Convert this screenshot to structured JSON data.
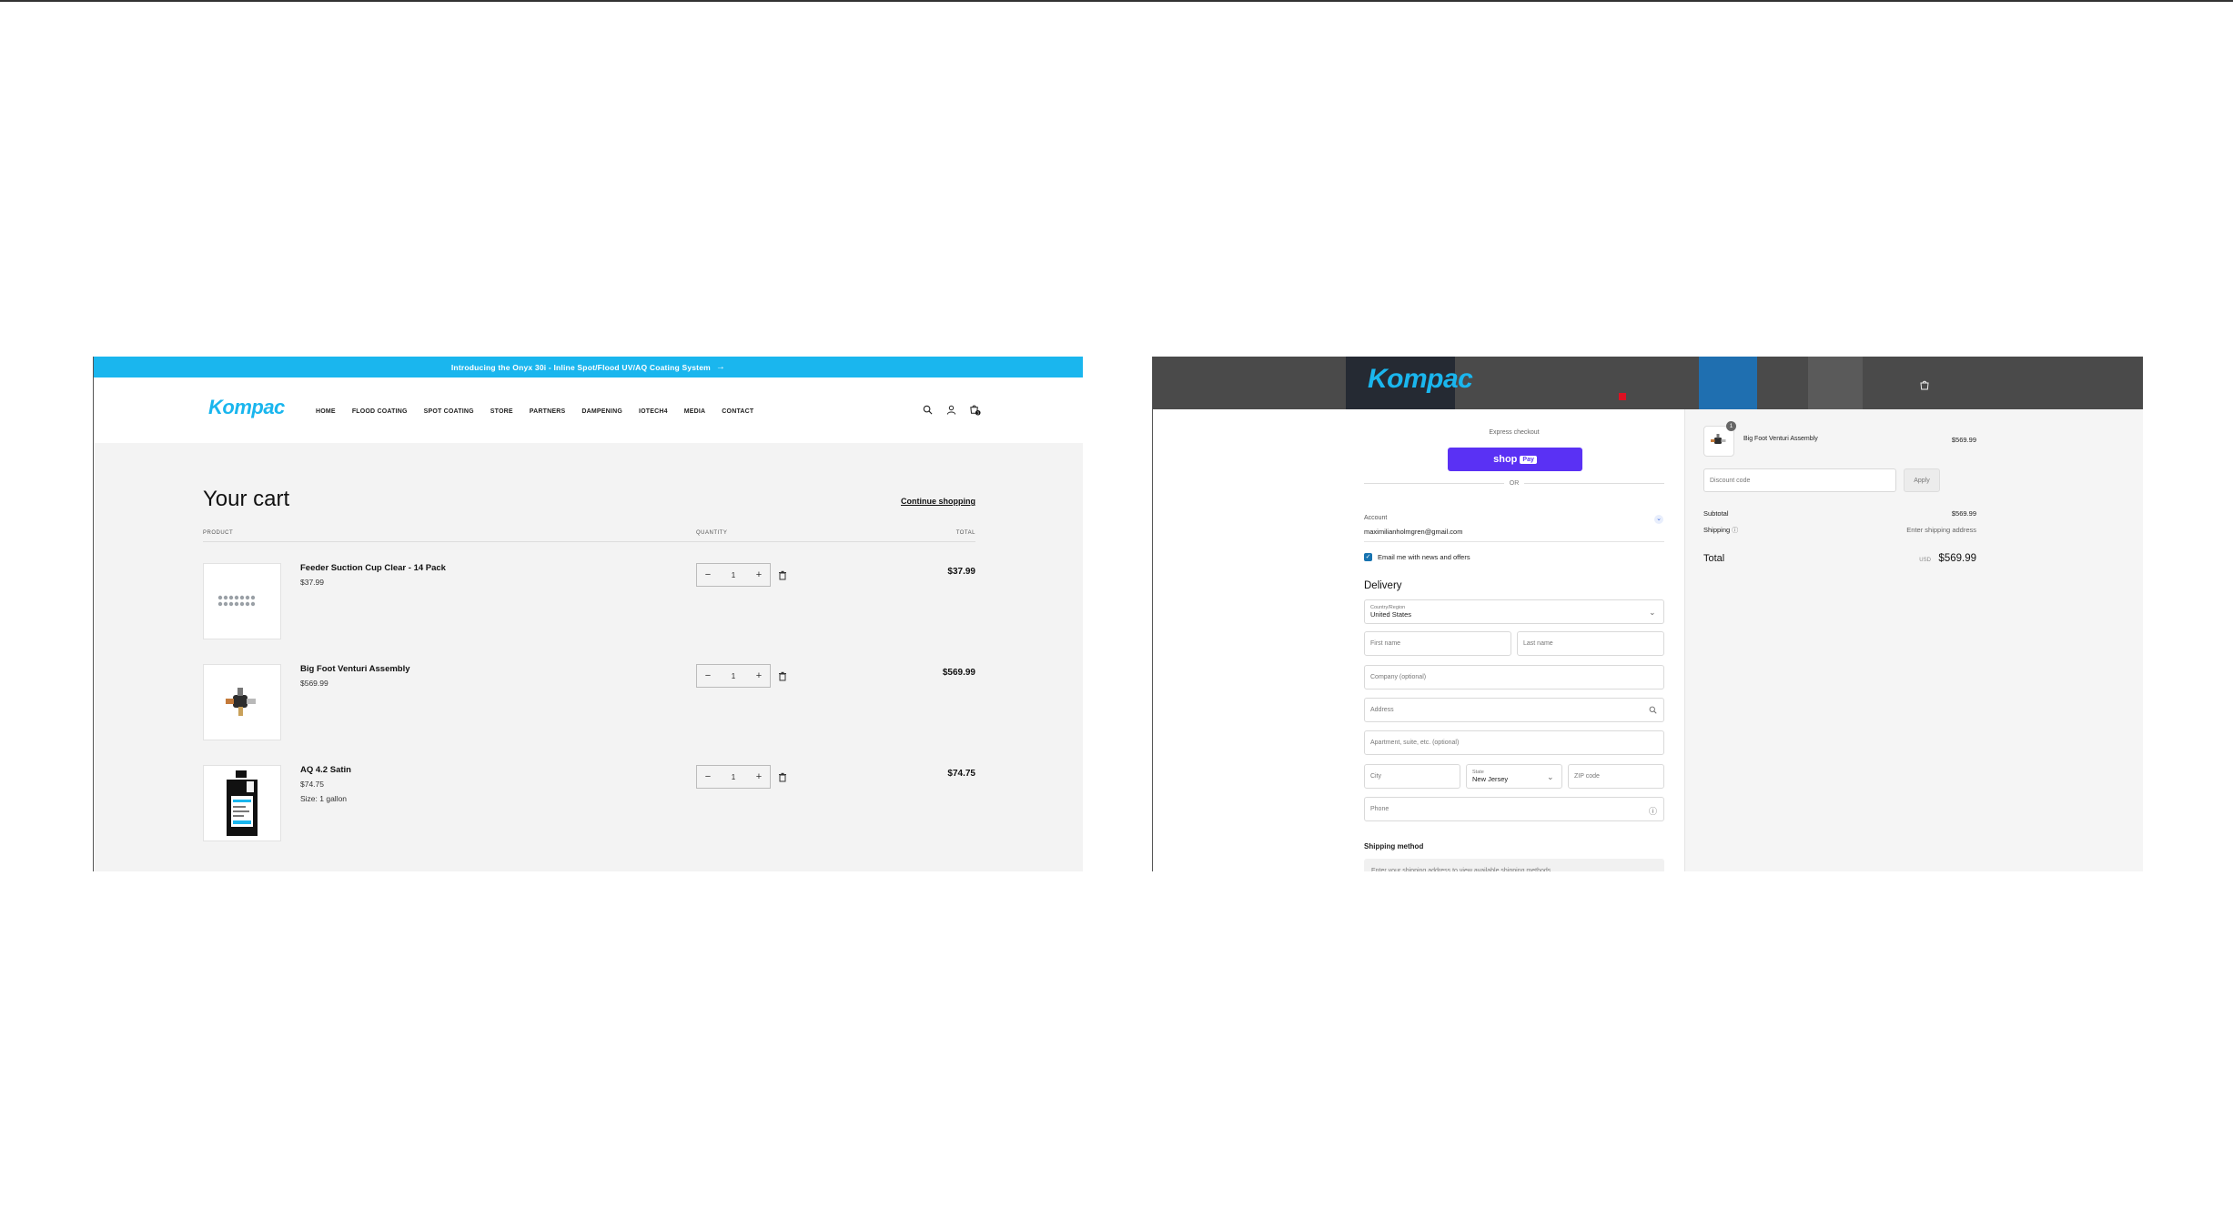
{
  "cart_page": {
    "announcement": "Introducing the Onyx 30i - Inline Spot/Flood UV/AQ Coating System",
    "announcement_arrow": "→",
    "logo": "Kompac",
    "nav": [
      "HOME",
      "FLOOD COATING",
      "SPOT COATING",
      "STORE",
      "PARTNERS",
      "DAMPENING",
      "IOTECH4",
      "MEDIA",
      "CONTACT"
    ],
    "cart_badge": "3",
    "title": "Your cart",
    "continue_shopping": "Continue shopping",
    "columns": {
      "product": "PRODUCT",
      "quantity": "QUANTITY",
      "total": "TOTAL"
    },
    "items": [
      {
        "name": "Feeder Suction Cup Clear - 14 Pack",
        "price": "$37.99",
        "variant": "",
        "qty": "1",
        "total": "$37.99"
      },
      {
        "name": "Big Foot Venturi Assembly",
        "price": "$569.99",
        "variant": "",
        "qty": "1",
        "total": "$569.99"
      },
      {
        "name": "AQ 4.2 Satin",
        "price": "$74.75",
        "variant": "Size: 1 gallon",
        "qty": "1",
        "total": "$74.75"
      }
    ],
    "qty_minus": "−",
    "qty_plus": "+"
  },
  "checkout_page": {
    "logo": "Kompac",
    "express_checkout": "Express checkout",
    "shop_pay": "shop",
    "shop_pay_badge": "Pay",
    "or": "OR",
    "account_label": "Account",
    "account_email": "maximilianholmgren@gmail.com",
    "email_news": "Email me with news and offers",
    "delivery": "Delivery",
    "country_label": "Country/Region",
    "country_value": "United States",
    "first_name": "First name",
    "last_name": "Last name",
    "company": "Company (optional)",
    "address": "Address",
    "apartment": "Apartment, suite, etc. (optional)",
    "city": "City",
    "state_label": "State",
    "state_value": "New Jersey",
    "zip": "ZIP code",
    "phone": "Phone",
    "shipping_method": "Shipping method",
    "shipping_info": "Enter your shipping address to view available shipping methods.",
    "summary": {
      "item_count": "1",
      "item_name": "Big Foot Venturi Assembly",
      "item_price": "$569.99",
      "discount_placeholder": "Discount code",
      "apply": "Apply",
      "subtotal_label": "Subtotal",
      "subtotal_value": "$569.99",
      "shipping_label": "Shipping",
      "shipping_value": "Enter shipping address",
      "total_label": "Total",
      "currency": "USD",
      "total_value": "$569.99"
    }
  },
  "colors": {
    "brand": "#1ab6ee",
    "shop_pay": "#5a31f4",
    "checkbox": "#1773b0"
  }
}
